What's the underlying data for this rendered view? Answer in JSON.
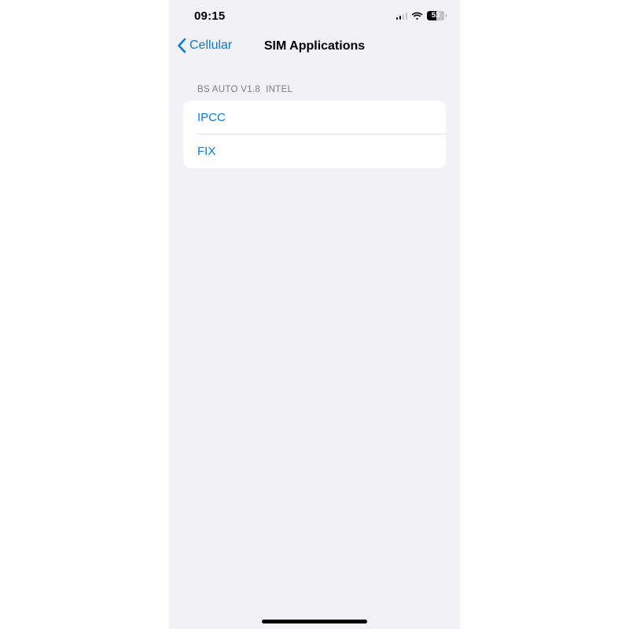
{
  "status_bar": {
    "time": "09:15",
    "battery_level": "53",
    "signal_icon": "cellular-signal-icon",
    "wifi_icon": "wifi-icon",
    "battery_icon": "battery-icon"
  },
  "nav": {
    "back_label": "Cellular",
    "back_icon": "chevron-left-icon",
    "title": "SIM Applications"
  },
  "section": {
    "header": "BS AUTO V1.8  INTEL",
    "items": [
      {
        "label": "IPCC"
      },
      {
        "label": "FIX"
      }
    ]
  },
  "colors": {
    "accent": "#0a7bd6",
    "background": "#f1f1f6",
    "card": "#ffffff",
    "secondary_text": "#7c7c81"
  }
}
